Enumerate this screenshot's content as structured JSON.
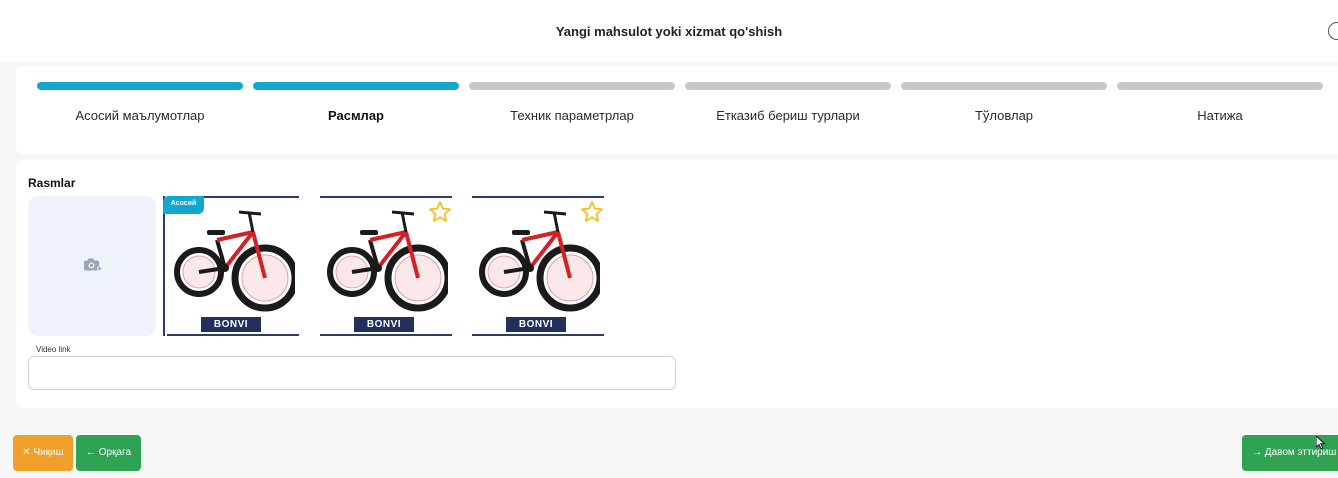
{
  "header": {
    "title": "Yangi mahsulot yoki xizmat qo'shish",
    "close_icon": "close-circle-icon"
  },
  "stepper": {
    "steps": [
      {
        "label": "Асосий маълумотлар",
        "state": "done"
      },
      {
        "label": "Расмлар",
        "state": "active"
      },
      {
        "label": "Техник параметрлар",
        "state": "pending"
      },
      {
        "label": "Етказиб бериш турлари",
        "state": "pending"
      },
      {
        "label": "Тўловлар",
        "state": "pending"
      },
      {
        "label": "Натижа",
        "state": "pending"
      }
    ],
    "colors": {
      "done": "#12a7cf",
      "pending": "#c9c9c9"
    }
  },
  "images_section": {
    "title": "Rasmlar",
    "upload_icon": "camera-add-icon",
    "images": [
      {
        "brand": "BONVI",
        "is_main": true,
        "main_label": "Асосий"
      },
      {
        "brand": "BONVI",
        "is_main": false,
        "star_icon": "star-outline-icon"
      },
      {
        "brand": "BONVI",
        "is_main": false,
        "star_icon": "star-outline-icon"
      }
    ],
    "video_link": {
      "label": "Video link",
      "value": "",
      "placeholder": ""
    }
  },
  "footer": {
    "exit_label": "✕ Чиқиш",
    "back_label": "← Орқага",
    "next_label": "→ Давом эттириш",
    "colors": {
      "exit": "#f0a02a",
      "primary": "#2ea354"
    }
  }
}
